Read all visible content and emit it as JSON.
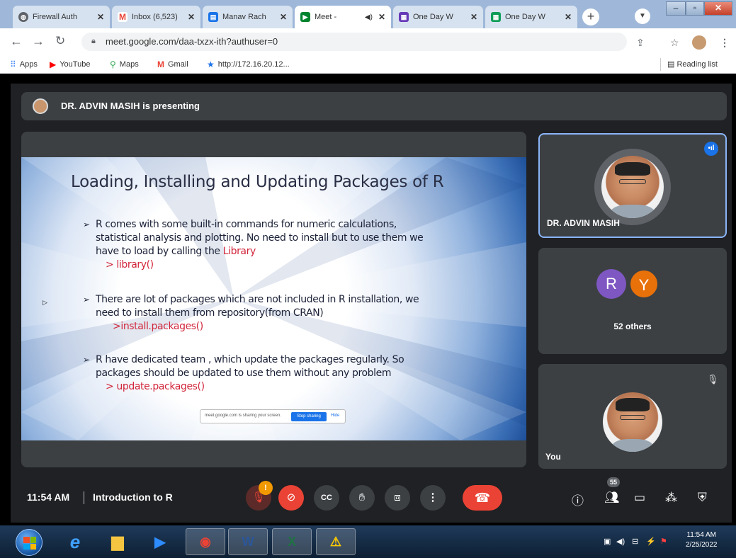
{
  "browser": {
    "tabs": [
      {
        "title": "Firewall Auth",
        "icon": "globe-icon",
        "color": "#5f6368"
      },
      {
        "title": "Inbox (6,523)",
        "icon": "gmail-icon",
        "color": "#ea4335"
      },
      {
        "title": "Manav Rach",
        "icon": "classroom-icon",
        "color": "#1a73e8"
      },
      {
        "title": "Meet - ",
        "icon": "meet-icon",
        "color": "#00832d"
      },
      {
        "title": "One Day W",
        "icon": "forms-icon",
        "color": "#673ab7"
      },
      {
        "title": "One Day W",
        "icon": "sheets-icon",
        "color": "#0f9d58"
      }
    ],
    "tab_close": "✕",
    "new_tab": "+",
    "url": "meet.google.com/daa-txzx-ith?authuser=0",
    "bookmarks": [
      {
        "label": "Apps",
        "icon": "apps-icon",
        "color": "#4285f4"
      },
      {
        "label": "YouTube",
        "icon": "youtube-icon",
        "color": "#ff0000"
      },
      {
        "label": "Maps",
        "icon": "maps-icon",
        "color": "#34a853"
      },
      {
        "label": "Gmail",
        "icon": "gmail-icon",
        "color": "#ea4335"
      },
      {
        "label": "http://172.16.20.12...",
        "icon": "star-icon",
        "color": "#1a73e8"
      }
    ],
    "reading_list": "Reading list"
  },
  "meet": {
    "presenter_banner": "DR. ADVIN MASIH is presenting",
    "slide": {
      "title": "Loading, Installing and Updating Packages of  R",
      "bullets": [
        {
          "lines": [
            "R comes with some  built-in commands for numeric calculations,",
            "statistical analysis  and plotting. No need to install but to use them we",
            "have to load by calling the "
          ],
          "highlight": "Library",
          "code": " > library()"
        },
        {
          "lines": [
            "There are lot of packages which are not included in R installation, we",
            "need to install them from repository(from CRAN)"
          ],
          "highlight": "",
          "code": ">install.packages()"
        },
        {
          "lines": [
            "R have dedicated team , which update the packages regularly. So",
            "packages should be updated to use them without any problem"
          ],
          "highlight": "",
          "code": "> update.packages()"
        }
      ],
      "share_notice": "meet.google.com is sharing your screen.",
      "share_stop": "Stop sharing",
      "share_hide": "Hide"
    },
    "tiles": {
      "presenter_name": "DR. ADVIN MASIH",
      "avatar_r": "R",
      "avatar_y": "Y",
      "others": "52 others",
      "self_name": "You"
    },
    "controls": {
      "time": "11:54 AM",
      "meeting_title": "Introduction to R",
      "mic_badge": "!",
      "people_count": "55"
    }
  },
  "taskbar": {
    "time": "11:54 AM",
    "date": "2/25/2022"
  }
}
